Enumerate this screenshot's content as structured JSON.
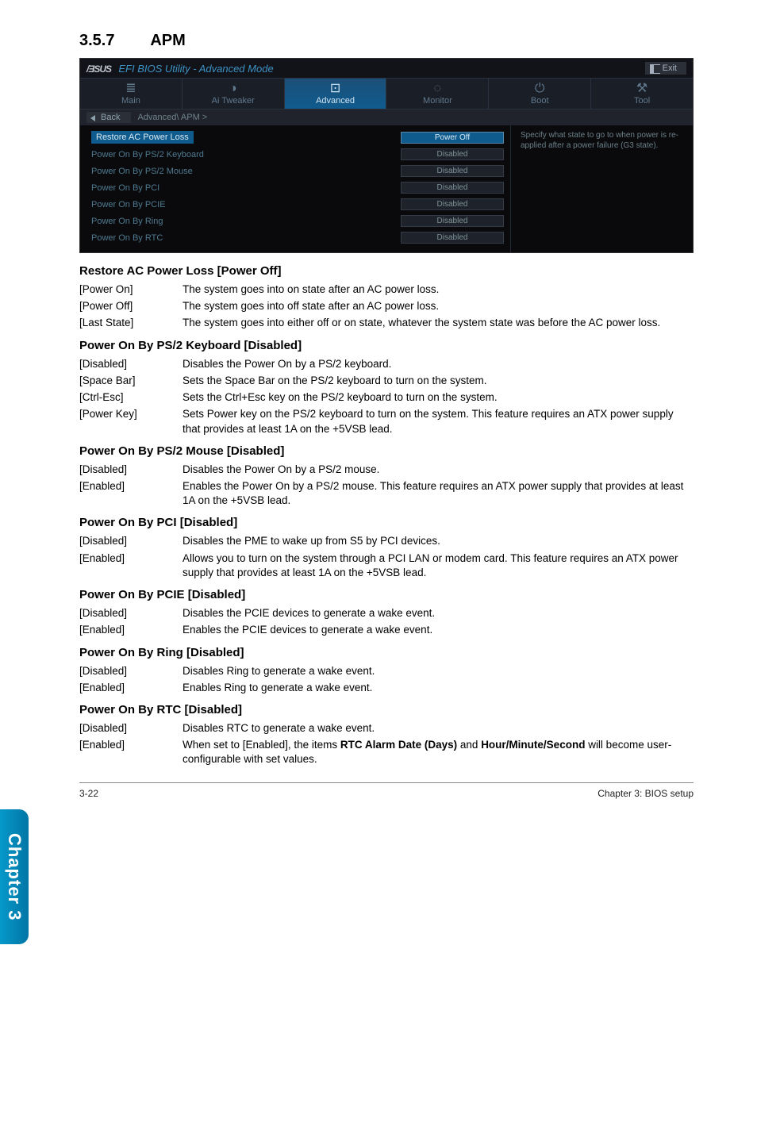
{
  "section": {
    "number": "3.5.7",
    "title": "APM"
  },
  "bios": {
    "brand": "/ƎSUS",
    "title": "EFI BIOS Utility - Advanced Mode",
    "exit": "Exit",
    "nav": [
      {
        "glyph": "≣",
        "label": "Main"
      },
      {
        "glyph": "◑",
        "label": "Ai Tweaker"
      },
      {
        "glyph": "⊡",
        "label": "Advanced"
      },
      {
        "glyph": "◌",
        "label": "Monitor"
      },
      {
        "glyph": "⏻",
        "label": "Boot"
      },
      {
        "glyph": "⚒",
        "label": "Tool"
      }
    ],
    "back": "Back",
    "breadcrumb": "Advanced\\ APM >",
    "rows": [
      {
        "label": "Restore AC Power Loss",
        "value": "Power Off",
        "selected": true
      },
      {
        "label": "Power On By PS/2 Keyboard",
        "value": "Disabled"
      },
      {
        "label": "Power On By PS/2 Mouse",
        "value": "Disabled"
      },
      {
        "label": "Power On By PCI",
        "value": "Disabled"
      },
      {
        "label": "Power On By PCIE",
        "value": "Disabled"
      },
      {
        "label": "Power On By Ring",
        "value": "Disabled"
      },
      {
        "label": "Power On By RTC",
        "value": "Disabled"
      }
    ],
    "help": "Specify what state to go to when power is re-applied after a power failure (G3 state)."
  },
  "sections": [
    {
      "heading": "Restore AC Power Loss [Power Off]",
      "items": [
        {
          "k": "[Power On]",
          "v": "The system goes into on state after an AC power loss."
        },
        {
          "k": "[Power Off]",
          "v": "The system goes into off state after an AC power loss."
        },
        {
          "k": "[Last State]",
          "v": "The system goes into either off or on state, whatever the system state was before the AC power loss."
        }
      ]
    },
    {
      "heading": "Power On By PS/2 Keyboard [Disabled]",
      "items": [
        {
          "k": "[Disabled]",
          "v": "Disables the Power On by a PS/2 keyboard."
        },
        {
          "k": "[Space Bar]",
          "v": "Sets the Space Bar on the PS/2 keyboard to turn on the system."
        },
        {
          "k": "[Ctrl-Esc]",
          "v": "Sets the Ctrl+Esc key on the PS/2 keyboard to turn on the system."
        },
        {
          "k": "[Power Key]",
          "v": "Sets Power key on the PS/2 keyboard to turn on the system. This feature requires an ATX power supply that provides at least 1A on the +5VSB lead."
        }
      ]
    },
    {
      "heading": "Power On By PS/2 Mouse [Disabled]",
      "items": [
        {
          "k": "[Disabled]",
          "v": "Disables the Power On by a PS/2 mouse."
        },
        {
          "k": "[Enabled]",
          "v": "Enables the Power On by a PS/2 mouse. This feature requires an ATX power supply that provides at least 1A on the +5VSB lead."
        }
      ]
    },
    {
      "heading": "Power On By PCI [Disabled]",
      "items": [
        {
          "k": "[Disabled]",
          "v": "Disables the PME to wake up from S5 by PCI devices."
        },
        {
          "k": "[Enabled]",
          "v": "Allows you to turn on the system through a PCI LAN or modem card. This feature requires an ATX power supply that provides at least 1A on the +5VSB lead."
        }
      ]
    },
    {
      "heading": "Power On By PCIE [Disabled]",
      "items": [
        {
          "k": "[Disabled]",
          "v": "Disables the PCIE devices to generate a wake event."
        },
        {
          "k": "[Enabled]",
          "v": "Enables the PCIE devices to generate a wake event."
        }
      ]
    },
    {
      "heading": "Power On By Ring [Disabled]",
      "items": [
        {
          "k": "[Disabled]",
          "v": "Disables Ring to generate a wake event."
        },
        {
          "k": "[Enabled]",
          "v": "Enables Ring to generate a wake event."
        }
      ]
    },
    {
      "heading": "Power On By RTC [Disabled]",
      "items": [
        {
          "k": "[Disabled]",
          "v": "Disables RTC to generate a wake event."
        },
        {
          "k": "[Enabled]",
          "v": "When set to [Enabled], the items <b>RTC Alarm Date (Days)</b> and <b>Hour/Minute/Second</b> will become user-configurable with set values."
        }
      ]
    }
  ],
  "sidebar": "Chapter 3",
  "footer": {
    "left": "3-22",
    "right": "Chapter 3: BIOS setup"
  }
}
